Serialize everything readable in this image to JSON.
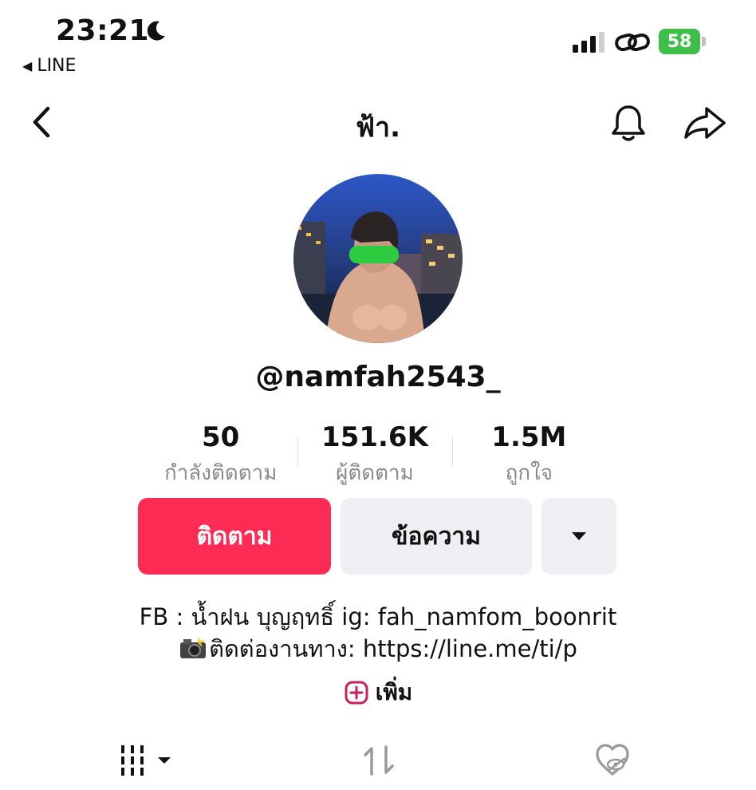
{
  "status_bar": {
    "time": "23:21",
    "back_app": "LINE",
    "battery": "58"
  },
  "header": {
    "title": "ฟ้า."
  },
  "profile": {
    "username": "@namfah2543_",
    "stats": [
      {
        "value": "50",
        "label": "กำลังติดตาม"
      },
      {
        "value": "151.6K",
        "label": "ผู้ติดตาม"
      },
      {
        "value": "1.5M",
        "label": "ถูกใจ"
      }
    ],
    "follow_label": "ติดตาม",
    "message_label": "ข้อความ",
    "bio_line1": "FB :  น้ำฝน บุญฤทธิ์ ig: fah_namfom_boonrit",
    "bio_line2": "ติดต่องานทาง: https://line.me/ti/p",
    "more_label": "เพิ่ม"
  },
  "colors": {
    "accent": "#fe2c55",
    "battery": "#3fbf4a",
    "secondary_button": "#efeff3",
    "muted_text": "#8a8a8a"
  },
  "icons": [
    "moon-icon",
    "signal-icon",
    "link-icon",
    "battery-icon",
    "back-chevron-icon",
    "bell-icon",
    "share-icon",
    "dropdown-caret-icon",
    "camera-flash-icon",
    "plus-square-icon",
    "grid-icon",
    "repost-icon",
    "liked-hidden-icon"
  ]
}
